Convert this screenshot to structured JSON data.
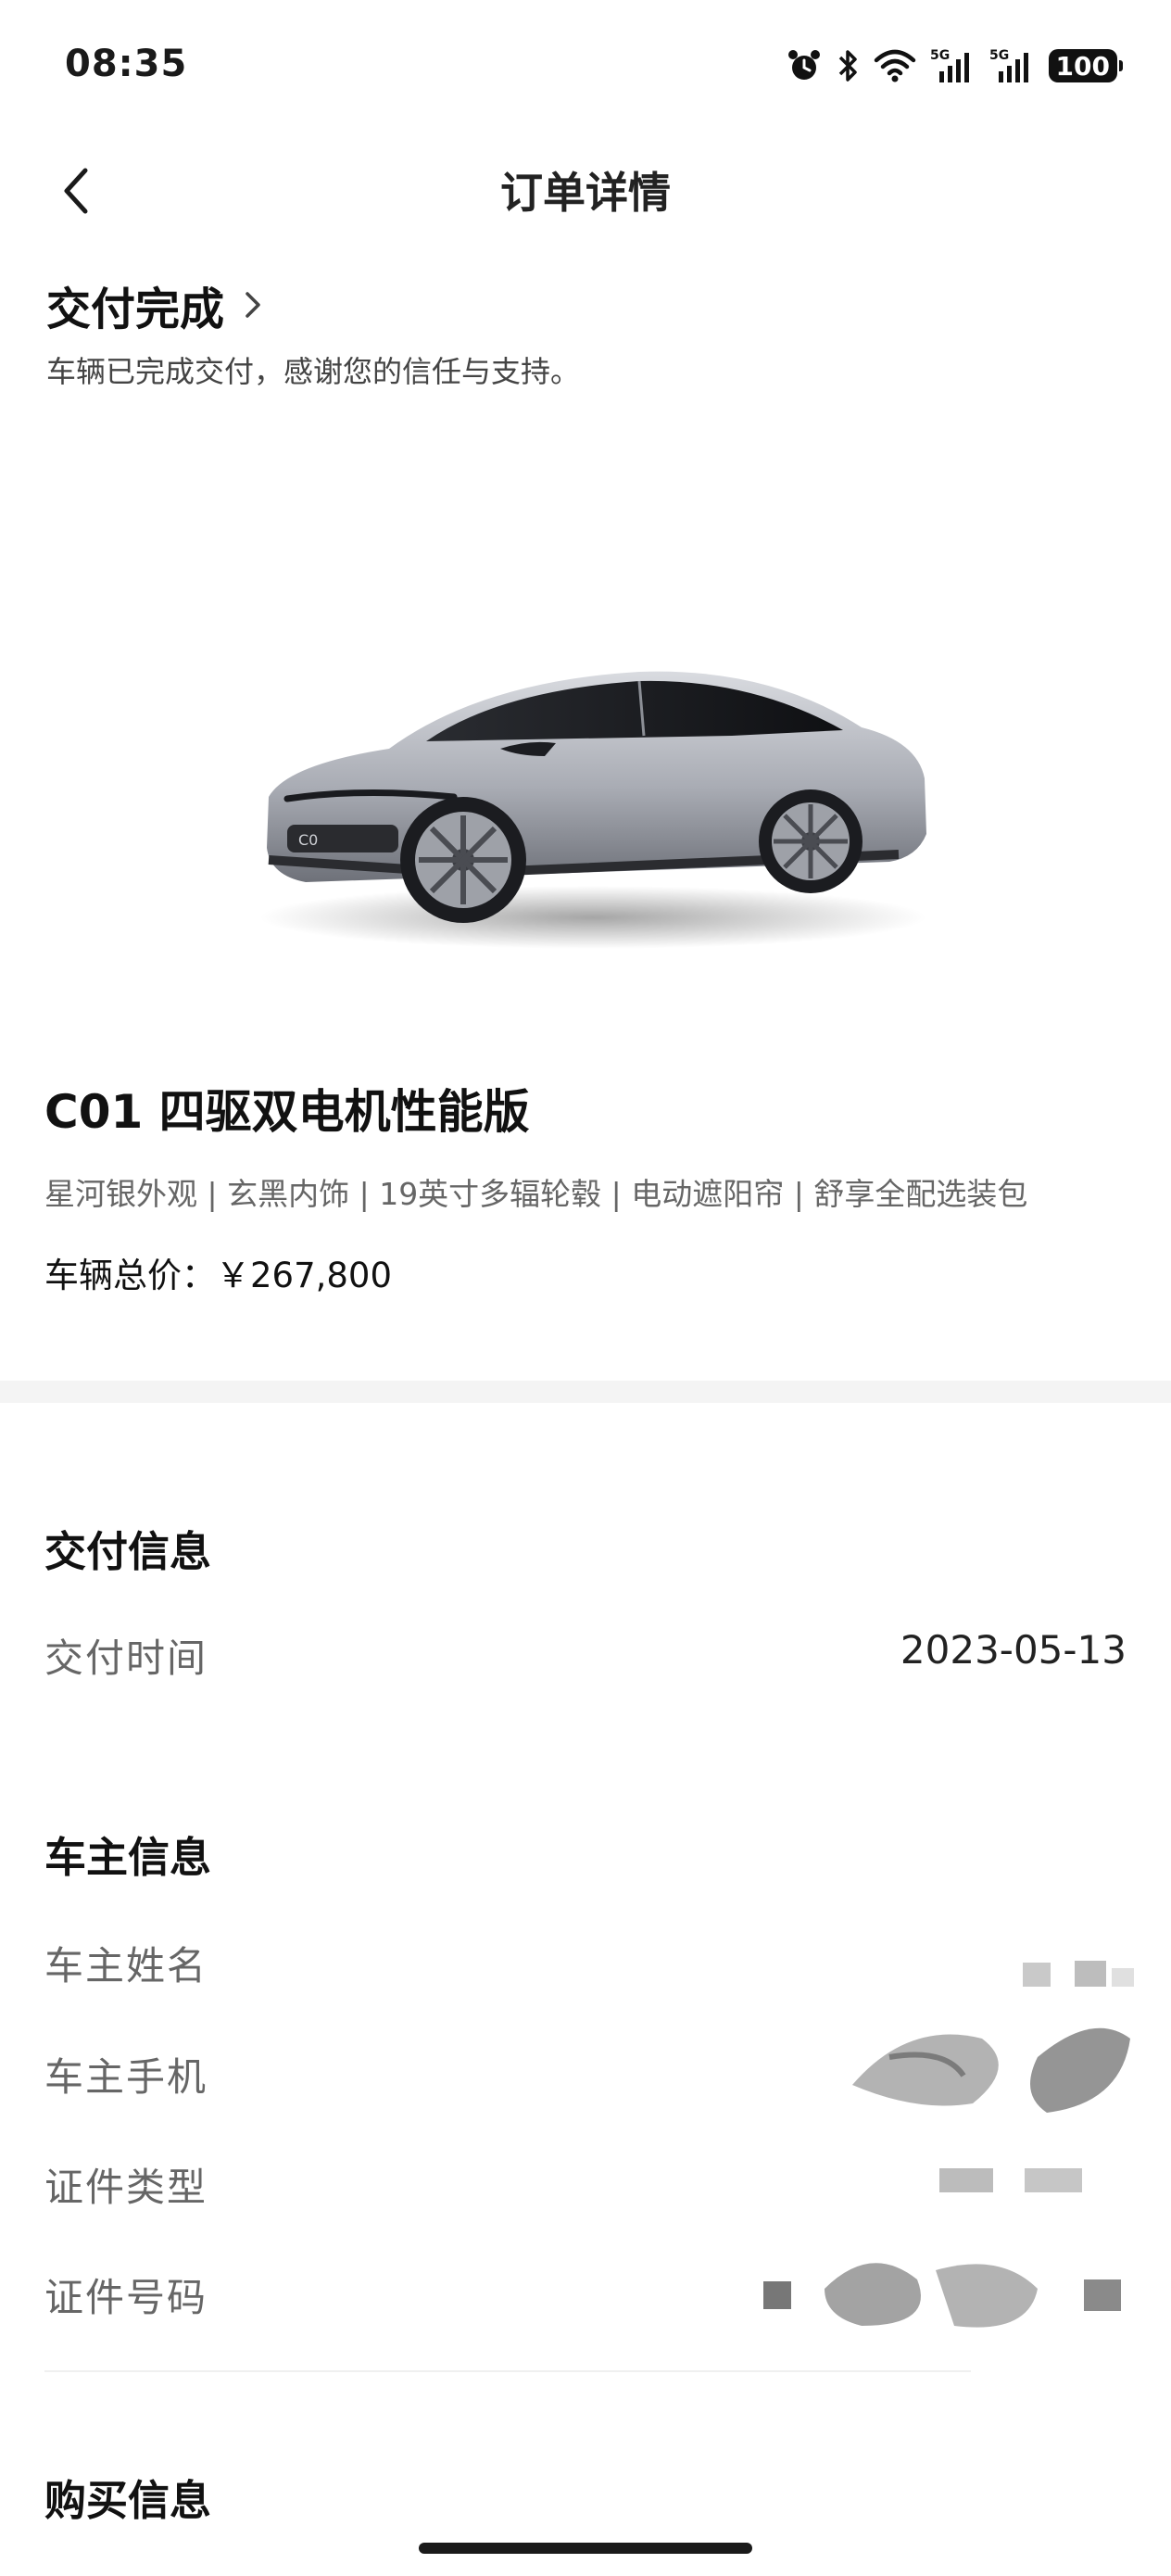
{
  "status_bar": {
    "time": "08:35",
    "icons": [
      "alarm-icon",
      "bluetooth-icon",
      "wifi-icon",
      "signal-5g-icon",
      "signal-5g-icon"
    ],
    "signal_label_1": "5G",
    "signal_label_2": "5G",
    "battery": "100"
  },
  "nav": {
    "back_icon": "chevron-left-icon",
    "title": "订单详情"
  },
  "delivery_status": {
    "title": "交付完成",
    "chevron_icon": "chevron-right-icon",
    "description": "车辆已完成交付，感谢您的信任与支持。"
  },
  "vehicle": {
    "image": "silver-sedan-car-photo",
    "model_name": "C01 四驱双电机性能版",
    "options": "星河银外观 | 玄黑内饰 | 19英寸多辐轮毂 | 电动遮阳帘 | 舒享全配选装包",
    "price_label": "车辆总价：",
    "price_value": "￥267,800"
  },
  "delivery_info": {
    "title": "交付信息",
    "rows": [
      {
        "label": "交付时间",
        "value": "2023-05-13"
      }
    ]
  },
  "owner_info": {
    "title": "车主信息",
    "rows": [
      {
        "label": "车主姓名"
      },
      {
        "label": "车主手机"
      },
      {
        "label": "证件类型"
      },
      {
        "label": "证件号码"
      }
    ]
  },
  "purchase_info": {
    "title": "购买信息"
  },
  "colors": {
    "background": "#ffffff",
    "divider": "#f4f4f4",
    "primary_text": "#111111",
    "secondary_text": "#666666"
  }
}
